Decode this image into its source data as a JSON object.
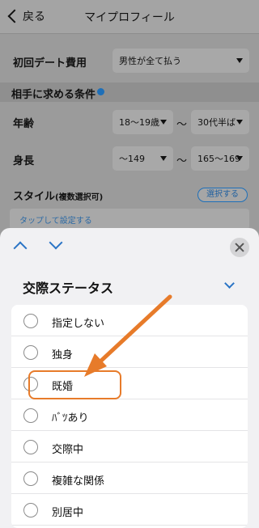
{
  "nav": {
    "back_label": "戻る",
    "title": "マイプロフィール"
  },
  "first_date_cost": {
    "label": "初回デート費用",
    "value": "男性が全て払う"
  },
  "conditions_section": {
    "title": "相手に求める条件"
  },
  "age": {
    "label": "年齢",
    "min": "18〜19歳",
    "max": "30代半ば",
    "separator": "〜"
  },
  "height": {
    "label": "身長",
    "min": "〜149",
    "max": "165〜169",
    "separator": "〜"
  },
  "style": {
    "label": "スタイル",
    "label_note": "(複数選択可)",
    "select_button": "選択する",
    "tap_placeholder": "タップして設定する"
  },
  "sheet": {
    "title": "交際ステータス",
    "options": [
      "指定しない",
      "独身",
      "既婚",
      "ﾊﾞﾂあり",
      "交際中",
      "複雑な関係",
      "別居中"
    ]
  },
  "colors": {
    "accent": "#2a74c5",
    "annotation": "#e77b2a"
  }
}
